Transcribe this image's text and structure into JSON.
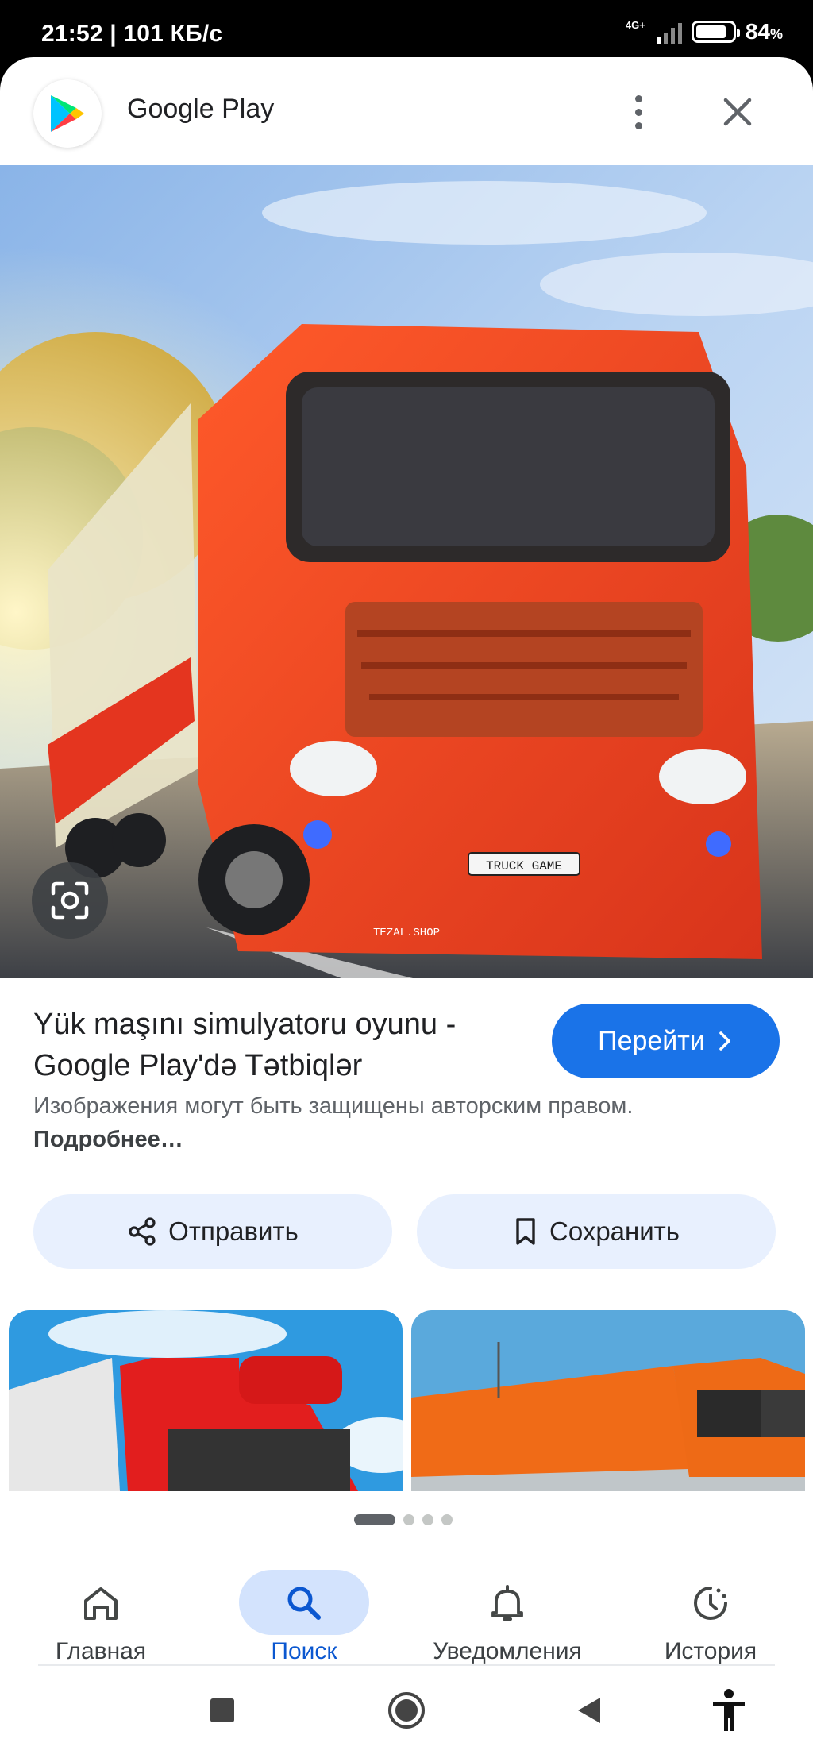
{
  "status_bar": {
    "time_speed": "21:52 | 101 КБ/с",
    "network_type": "4G+",
    "battery_level": 84,
    "battery_text": "84",
    "battery_unit": "%"
  },
  "header": {
    "app_title": "Google Play",
    "logo_icon": "google-play-logo",
    "more_icon": "more-vertical-icon",
    "close_icon": "close-icon"
  },
  "hero": {
    "watermark": "TEZAL.SHOP",
    "plate_text": "TRUCK GAME",
    "lens_icon": "google-lens-icon"
  },
  "result": {
    "title_line1": "Yük maşını simulyatoru oyunu -",
    "title_line2": "Google Play'də Tətbiqlər",
    "visit_label": "Перейти",
    "copyright_text": "Изображения могут быть защищены авторским правом.",
    "more_link": "Подробнее…"
  },
  "actions": {
    "share_label": "Отправить",
    "save_label": "Сохранить"
  },
  "pager": {
    "current": 1,
    "total": 4
  },
  "bottom_nav": {
    "items": [
      {
        "label": "Главная",
        "icon": "home-icon",
        "active": false
      },
      {
        "label": "Поиск",
        "icon": "search-icon",
        "active": true
      },
      {
        "label": "Уведомления",
        "icon": "bell-icon",
        "active": false
      },
      {
        "label": "История",
        "icon": "history-icon",
        "active": false
      }
    ]
  },
  "system_nav": {
    "icons": [
      "recents-square-icon",
      "home-circle-icon",
      "back-triangle-icon",
      "accessibility-icon"
    ]
  },
  "colors": {
    "accent": "#1a73e8",
    "pill_bg": "#e8f0fe",
    "nav_active_bg": "#d3e3fd"
  }
}
